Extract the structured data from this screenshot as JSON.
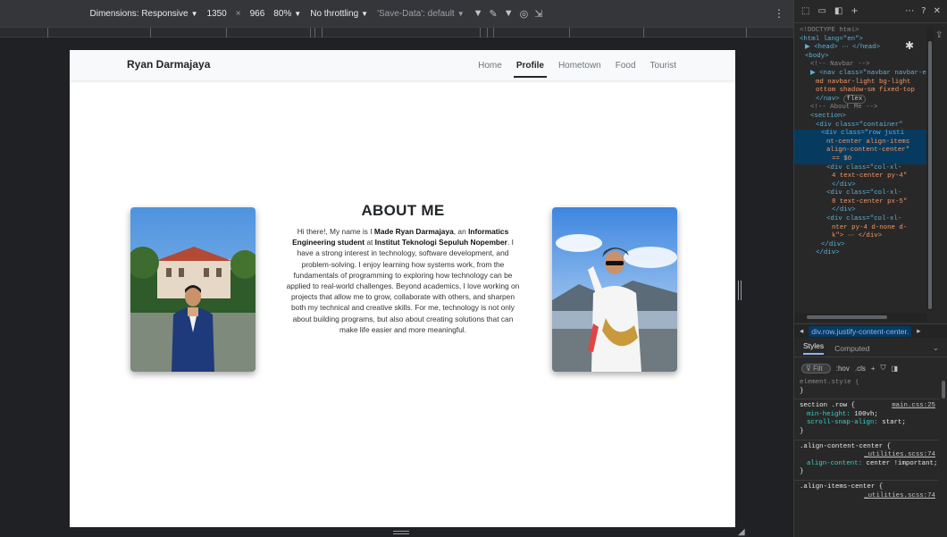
{
  "device_toolbar": {
    "dimensions_label": "Dimensions: Responsive",
    "width": "1350",
    "times": "×",
    "height": "966",
    "zoom": "80%",
    "throttling": "No throttling",
    "save_data": "'Save-Data': default",
    "more_icon": "kebab-icon"
  },
  "page": {
    "brand": "Ryan Darmajaya",
    "nav": [
      "Home",
      "Profile",
      "Hometown",
      "Food",
      "Tourist"
    ],
    "active_nav": "Profile",
    "about": {
      "title": "ABOUT ME",
      "p1": "Hi there!, My name is I ",
      "name": "Made Ryan Darmajaya",
      "p2": ", an ",
      "major": "Informatics Engineering student",
      "p3": " at ",
      "school": "Institut Teknologi Sepuluh Nopember",
      "p4": ". I have a strong interest in technology, software development, and problem-solving. I enjoy learning how systems work, from the fundamentals of programming to exploring how technology can be applied to real-world challenges. Beyond academics, I love working on projects that allow me to grow, collaborate with others, and sharpen both my technical and creative skills. For me, technology is not only about building programs, but also about creating solutions that can make life easier and more meaningful."
    },
    "colors": {
      "sky": "#6aa6e0",
      "suit": "#1f3a7a",
      "brand_text": "#212529"
    }
  },
  "devtools": {
    "elements": [
      {
        "html": "<!DOCTYPE html>",
        "indent": 0
      },
      {
        "tag": "html",
        "attr": "lang",
        "val": "en",
        "indent": 0
      },
      {
        "collapsed": "<head> ⋯ </head>",
        "indent": 1
      },
      {
        "tag": "body",
        "indent": 1
      },
      {
        "comment": "<!-- Navbar -->",
        "indent": 2
      },
      {
        "nav": "<nav class=\"navbar navbar-expand-md navbar-light bg-light b",
        "indent": 2
      },
      {
        "raw": "md navbar-light bg-light",
        "indent": 3
      },
      {
        "raw": "ottom shadow-sm fixed-top",
        "indent": 3
      },
      {
        "raw": "</nav>",
        "indent": 3,
        "badge": "flex"
      },
      {
        "comment": "<!-- About Me -->",
        "indent": 2
      },
      {
        "raw": "<section>",
        "indent": 2
      },
      {
        "raw": "<div class=\"container\"",
        "indent": 3
      },
      {
        "raw": "<div class=\"row justi",
        "indent": 4,
        "sel": true
      },
      {
        "raw": "nt-center align-items",
        "indent": 5,
        "sel": true
      },
      {
        "raw": "align-content-center\"",
        "indent": 5,
        "sel": true
      },
      {
        "raw": "== $0",
        "indent": 6,
        "sel": true
      },
      {
        "raw": "<div class=\"col-xl-",
        "indent": 5
      },
      {
        "raw": "4 text-center py-4\"",
        "indent": 6
      },
      {
        "raw": "</div>",
        "indent": 6
      },
      {
        "raw": "<div class=\"col-xl-",
        "indent": 5
      },
      {
        "raw": "8 text-center px-5\"",
        "indent": 6
      },
      {
        "raw": "</div>",
        "indent": 6
      },
      {
        "raw": "<div class=\"col-xl-",
        "indent": 5
      },
      {
        "raw": "nter py-4 d-none d-",
        "indent": 6
      },
      {
        "raw": "k\"> ⋯ </div>",
        "indent": 6
      },
      {
        "raw": "</div>",
        "indent": 4
      },
      {
        "raw": "</div>",
        "indent": 3
      }
    ],
    "breadcrumb": "div.row.justify-content-center.",
    "tabs": [
      "Styles",
      "Computed"
    ],
    "filter_placeholder": "Filt",
    "filter_tools": [
      ":hov",
      ".cls"
    ],
    "styles": {
      "element_style": "element.style {",
      "rule1_selector": "section .row {",
      "rule1_source": "main.css:25",
      "rule1_props": [
        [
          "min-height",
          "100vh;"
        ],
        [
          "scroll-snap-align",
          "start;"
        ]
      ],
      "rule2_selector": ".align-content-center {",
      "rule2_source": "_utilities.scss:74",
      "rule2_props": [
        [
          "align-content",
          "center !important;"
        ]
      ],
      "rule3_selector": ".align-items-center {",
      "rule3_source": "_utilities.scss:74"
    }
  }
}
